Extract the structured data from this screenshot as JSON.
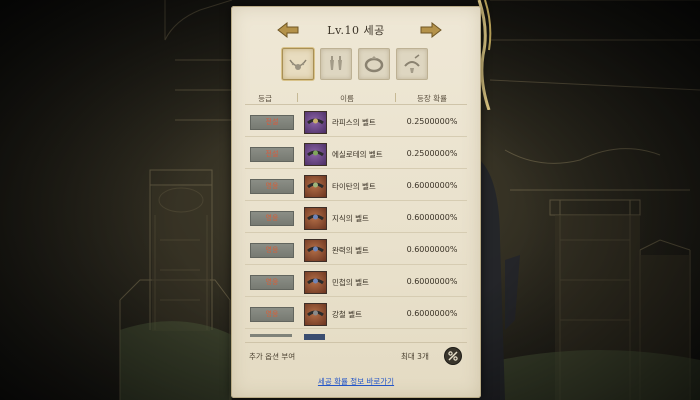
{
  "header": {
    "title": "Lv.10 세공"
  },
  "categories": [
    {
      "icon": "necklace-icon",
      "active": true
    },
    {
      "icon": "earring-icon",
      "active": false
    },
    {
      "icon": "ring-icon",
      "active": false
    },
    {
      "icon": "bracelet-icon",
      "active": false
    }
  ],
  "table": {
    "columns": {
      "grade": "등급",
      "name": "이름",
      "prob": "등장 확률"
    },
    "rows": [
      {
        "grade": "전설",
        "name": "라피스의 벨트",
        "prob": "0.2500000%",
        "icon_color": "purple"
      },
      {
        "grade": "전설",
        "name": "에실로테의 벨트",
        "prob": "0.2500000%",
        "icon_color": "purple"
      },
      {
        "grade": "영웅",
        "name": "타이탄의 벨트",
        "prob": "0.6000000%",
        "icon_color": "orange"
      },
      {
        "grade": "영웅",
        "name": "지식의 벨트",
        "prob": "0.6000000%",
        "icon_color": "orange"
      },
      {
        "grade": "영웅",
        "name": "완력의 벨트",
        "prob": "0.6000000%",
        "icon_color": "orange"
      },
      {
        "grade": "영웅",
        "name": "민첩의 벨트",
        "prob": "0.6000000%",
        "icon_color": "orange"
      },
      {
        "grade": "영웅",
        "name": "강철 벨트",
        "prob": "0.6000000%",
        "icon_color": "orange"
      }
    ]
  },
  "footer": {
    "extra_option_label": "추가 옵션 부여",
    "max_label": "최대 3개",
    "link_label": "세공 확률 정보 바로가기"
  },
  "colors": {
    "legend_text": "#d95a3b",
    "hero_text": "#d4603a",
    "link": "#2255c8",
    "panel_bg": "#efe8d6"
  }
}
